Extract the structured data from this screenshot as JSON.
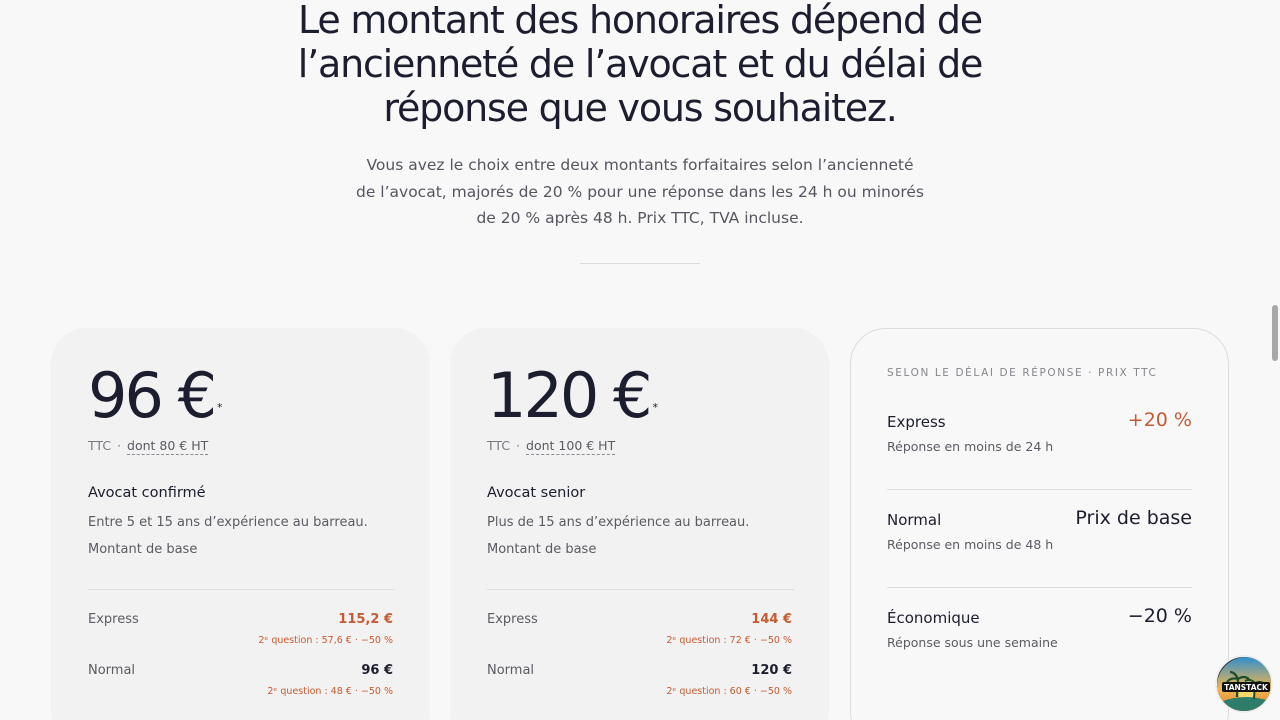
{
  "hero": {
    "title_lines": [
      "Le montant des honoraires dépend de",
      "l’ancienneté de l’avocat et du délai de",
      "réponse que vous souhaitez."
    ],
    "subtitle_lines": [
      "Vous avez le choix entre deux montants forfaitaires selon l’ancienneté",
      "de l’avocat, majorés de 20 % pour une réponse dans les 24 h ou minorés",
      "de 20 % après 48 h. Prix TTC, TVA incluse."
    ]
  },
  "cards": [
    {
      "price": "96 €",
      "asterisk": "*",
      "ttc": "TTC",
      "dot": "·",
      "ht": "dont 80 € HT",
      "name": "Avocat confirmé",
      "description": "Entre 5 et 15 ans d’expérience au barreau.",
      "base_label": "Montant de base",
      "rows": [
        {
          "label": "Express",
          "value": "115,2 €",
          "note": "2ᵉ question : 57,6 € · −50 %"
        },
        {
          "label": "Normal",
          "value": "96 €",
          "note": "2ᵉ question : 48 € · −50 %"
        }
      ]
    },
    {
      "price": "120 €",
      "asterisk": "*",
      "ttc": "TTC",
      "dot": "·",
      "ht": "dont 100 € HT",
      "name": "Avocat senior",
      "description": "Plus de 15 ans d’expérience au barreau.",
      "base_label": "Montant de base",
      "rows": [
        {
          "label": "Express",
          "value": "144 €",
          "note": "2ᵉ question : 72 € · −50 %"
        },
        {
          "label": "Normal",
          "value": "120 €",
          "note": "2ᵉ question : 60 € · −50 %"
        }
      ]
    }
  ],
  "panel": {
    "heading": "SELON LE DÉLAI DE RÉPONSE · PRIX TTC",
    "rows": [
      {
        "name": "Express",
        "description": "Réponse en moins de 24 h",
        "value": "+20 %"
      },
      {
        "name": "Normal",
        "description": "Réponse en moins de 48 h",
        "value": "Prix de base"
      },
      {
        "name": "Économique",
        "description": "Réponse sous une semaine",
        "value": "−20 %"
      }
    ]
  },
  "badge": {
    "label": "TANSTACK"
  },
  "colors": {
    "accent": "#c75a30",
    "text": "#1c1d2e",
    "muted": "#5a5b63",
    "card_bg": "#f2f2f2",
    "page_bg": "#f8f8f8"
  }
}
